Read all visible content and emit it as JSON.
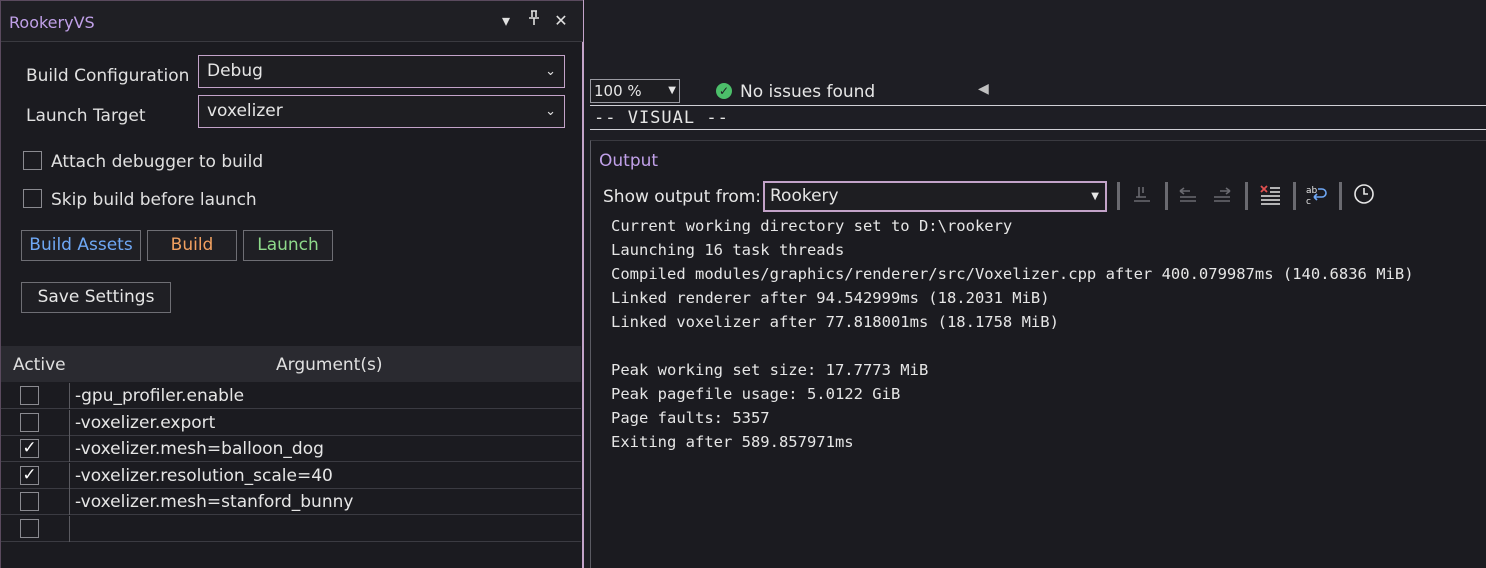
{
  "tool_window": {
    "title": "RookeryVS",
    "build_configuration_label": "Build Configuration",
    "build_configuration_value": "Debug",
    "launch_target_label": "Launch Target",
    "launch_target_value": "voxelizer",
    "attach_debugger_label": "Attach debugger to build",
    "skip_build_label": "Skip build before launch",
    "buttons": {
      "build_assets": "Build Assets",
      "build": "Build",
      "launch": "Launch",
      "save_settings": "Save Settings"
    },
    "colors": {
      "build_assets": "#6fa8f5",
      "build": "#f0a060",
      "launch": "#8ed98a",
      "accent": "#c3a3c9"
    },
    "grid": {
      "col_active": "Active",
      "col_arguments": "Argument(s)",
      "rows": [
        {
          "checked": false,
          "arg": "-gpu_profiler.enable"
        },
        {
          "checked": false,
          "arg": "-voxelizer.export"
        },
        {
          "checked": true,
          "arg": "-voxelizer.mesh=balloon_dog"
        },
        {
          "checked": true,
          "arg": "-voxelizer.resolution_scale=40"
        },
        {
          "checked": false,
          "arg": "-voxelizer.mesh=stanford_bunny"
        },
        {
          "checked": false,
          "arg": ""
        }
      ]
    }
  },
  "editor": {
    "zoom": "100 %",
    "issues_status": "No issues found",
    "visual_line": "-- VISUAL --"
  },
  "output": {
    "title": "Output",
    "show_output_from_label": "Show output from:",
    "show_output_from_value": "Rookery",
    "lines": [
      "Current working directory set to D:\\rookery",
      "Launching 16 task threads",
      "Compiled modules/graphics/renderer/src/Voxelizer.cpp after 400.079987ms (140.6836 MiB)",
      "Linked renderer after 94.542999ms (18.2031 MiB)",
      "Linked voxelizer after 77.818001ms (18.1758 MiB)",
      "",
      "Peak working set size: 17.7773 MiB",
      "Peak pagefile usage: 5.0122 GiB",
      "Page faults: 5357",
      "Exiting after 589.857971ms"
    ]
  },
  "icons": {
    "dropdown": "chevron-down-icon",
    "pin": "pin-icon",
    "close": "close-icon",
    "check": "check-circle-icon"
  }
}
